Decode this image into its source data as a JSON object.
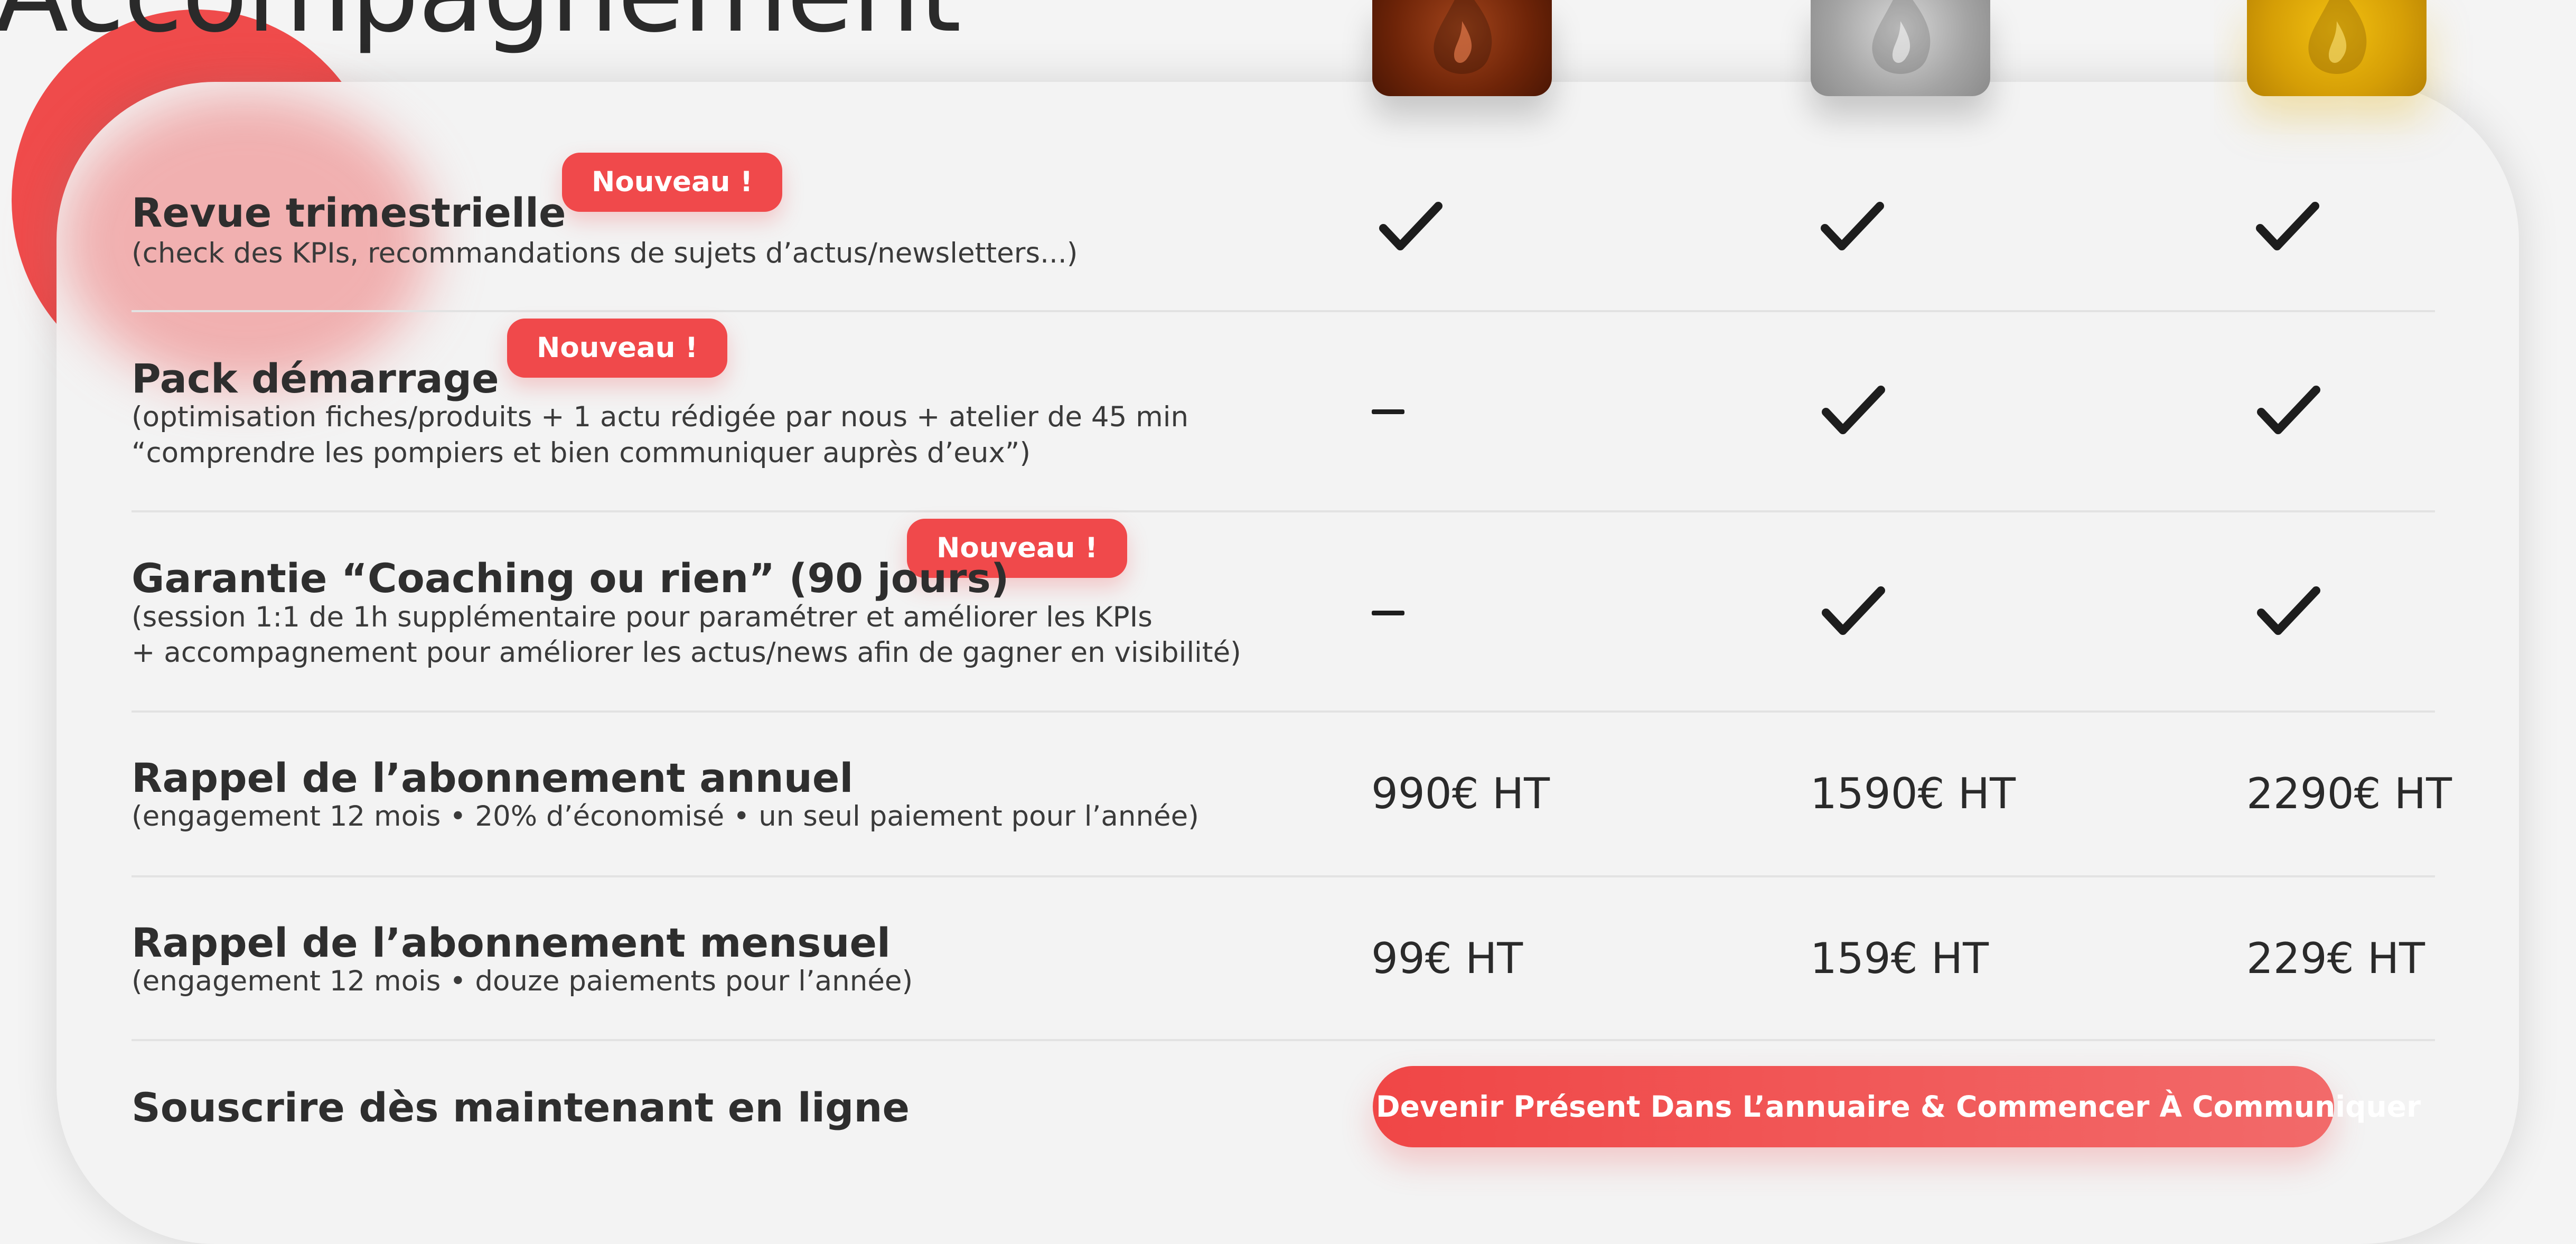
{
  "page": {
    "title": "Accompagnement",
    "new_badge_label": "Nouveau !"
  },
  "colors": {
    "accent": "#f0494b",
    "bronze": "#7a2a0a",
    "silver": "#a9a9a9",
    "gold": "#d8a30a"
  },
  "plans": [
    {
      "icon": "bronze-flame-badge-icon",
      "annual_price": "990€ HT",
      "monthly_price": "99€ HT"
    },
    {
      "icon": "silver-flame-badge-icon",
      "annual_price": "1590€ HT",
      "monthly_price": "159€ HT"
    },
    {
      "icon": "gold-flame-badge-icon",
      "annual_price": "2290€ HT",
      "monthly_price": "229€ HT"
    }
  ],
  "features": [
    {
      "title": "Revue trimestrielle",
      "subtitle": "(check des KPIs, recommandations de sujets d’actus/newsletters...)",
      "is_new": true,
      "availability": [
        "check",
        "check",
        "check"
      ]
    },
    {
      "title": "Pack démarrage",
      "subtitle_lines": [
        "(optimisation fiches/produits + 1 actu rédigée par nous + atelier de 45 min",
        "“comprendre les pompiers et bien communiquer auprès d’eux”)"
      ],
      "is_new": true,
      "availability": [
        "dash",
        "check",
        "check"
      ]
    },
    {
      "title": "Garantie “Coaching ou rien” (90 jours)",
      "subtitle_lines": [
        "(session 1:1 de 1h supplémentaire pour paramétrer et améliorer les KPIs",
        "+ accompagnement pour améliorer les actus/news afin de gagner en visibilité)"
      ],
      "is_new": true,
      "availability": [
        "dash",
        "check",
        "check"
      ]
    }
  ],
  "pricing_rows": {
    "annual": {
      "title": "Rappel de l’abonnement annuel",
      "subtitle": "(engagement 12 mois • 20% d’économisé • un seul paiement pour l’année)"
    },
    "monthly": {
      "title": "Rappel de l’abonnement mensuel",
      "subtitle": "(engagement 12 mois • douze paiements pour l’année)"
    }
  },
  "subscribe": {
    "label": "Souscrire dès maintenant en ligne",
    "cta_label": "Devenir Présent Dans L’annuaire & Commencer À Communiquer"
  }
}
